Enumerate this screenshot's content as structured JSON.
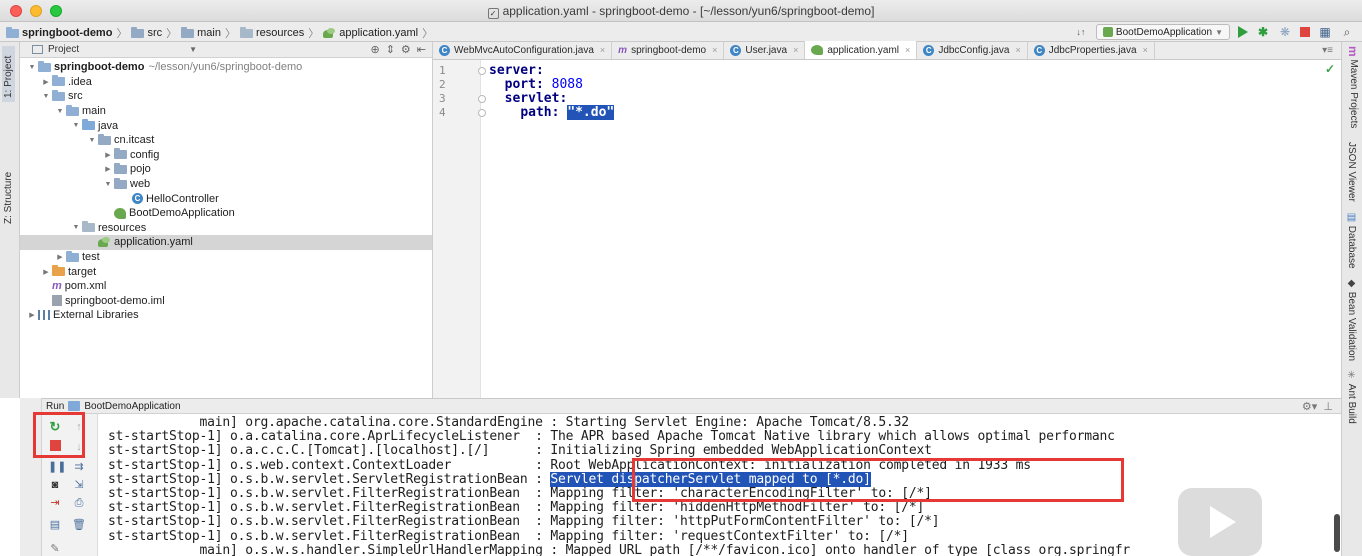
{
  "window": {
    "title": "application.yaml - springboot-demo - [~/lesson/yun6/springboot-demo]"
  },
  "breadcrumbs": [
    "springboot-demo",
    "src",
    "main",
    "resources",
    "application.yaml"
  ],
  "toolbar": {
    "run_config": "BootDemoApplication",
    "sort_indicator": "↓↑"
  },
  "left_strip": {
    "project_tab": "1: Project",
    "structure_tab": "Z: Structure"
  },
  "right_strip": {
    "tabs": [
      "Maven Projects",
      "JSON Viewer",
      "Database",
      "Bean Validation",
      "Ant Build"
    ]
  },
  "project_panel": {
    "header_label": "Project",
    "tree": [
      {
        "label": "springboot-demo",
        "path": "~/lesson/yun6/springboot-demo",
        "depth": 0,
        "expanded": true,
        "icon": "folder-icon",
        "bold": true
      },
      {
        "label": ".idea",
        "depth": 1,
        "expanded": false,
        "icon": "folder-icon"
      },
      {
        "label": "src",
        "depth": 1,
        "expanded": true,
        "icon": "folder-icon"
      },
      {
        "label": "main",
        "depth": 2,
        "expanded": true,
        "icon": "folder-icon"
      },
      {
        "label": "java",
        "depth": 3,
        "expanded": true,
        "icon": "source-folder-icon"
      },
      {
        "label": "cn.itcast",
        "depth": 4,
        "expanded": true,
        "icon": "package-icon"
      },
      {
        "label": "config",
        "depth": 5,
        "expanded": false,
        "icon": "package-icon"
      },
      {
        "label": "pojo",
        "depth": 5,
        "expanded": false,
        "icon": "package-icon"
      },
      {
        "label": "web",
        "depth": 5,
        "expanded": true,
        "icon": "package-icon"
      },
      {
        "label": "HelloController",
        "depth": 6,
        "icon": "class-icon"
      },
      {
        "label": "BootDemoApplication",
        "depth": 5,
        "icon": "spring-boot-icon"
      },
      {
        "label": "resources",
        "depth": 3,
        "expanded": true,
        "icon": "resources-folder-icon"
      },
      {
        "label": "application.yaml",
        "depth": 4,
        "icon": "yaml-icon",
        "selected": true
      },
      {
        "label": "test",
        "depth": 2,
        "expanded": false,
        "icon": "folder-icon"
      },
      {
        "label": "target",
        "depth": 1,
        "expanded": false,
        "icon": "excluded-folder-icon"
      },
      {
        "label": "pom.xml",
        "depth": 1,
        "icon": "maven-icon"
      },
      {
        "label": "springboot-demo.iml",
        "depth": 1,
        "icon": "iml-icon"
      },
      {
        "label": "External Libraries",
        "depth": 0,
        "expanded": false,
        "icon": "library-icon"
      }
    ]
  },
  "editor_tabs": [
    {
      "label": "WebMvcAutoConfiguration.java",
      "icon": "class-icon",
      "active": false
    },
    {
      "label": "springboot-demo",
      "icon": "maven-icon",
      "active": false
    },
    {
      "label": "User.java",
      "icon": "class-icon",
      "active": false
    },
    {
      "label": "application.yaml",
      "icon": "yaml-icon",
      "active": true
    },
    {
      "label": "JdbcConfig.java",
      "icon": "class-icon",
      "active": false
    },
    {
      "label": "JdbcProperties.java",
      "icon": "class-icon",
      "active": false
    }
  ],
  "editor": {
    "lines": [
      {
        "number": "1",
        "key": "server:",
        "value": ""
      },
      {
        "number": "2",
        "key": "port:",
        "value": "8088"
      },
      {
        "number": "3",
        "key": "servlet:",
        "value": ""
      },
      {
        "number": "4",
        "key": "path:",
        "value": "\"*.do\""
      }
    ]
  },
  "run_panel": {
    "label": "Run",
    "config_name": "BootDemoApplication",
    "console_lines": [
      {
        "thread": "            main]",
        "logger": "org.apache.catalina.core.StandardEngine",
        "message": ": Starting Servlet Engine: Apache Tomcat/8.5.32"
      },
      {
        "thread": "st-startStop-1]",
        "logger": "o.a.catalina.core.AprLifecycleListener",
        "message": ": The APR based Apache Tomcat Native library which allows optimal performanc"
      },
      {
        "thread": "st-startStop-1]",
        "logger": "o.a.c.c.C.[Tomcat].[localhost].[/]",
        "message": ": Initializing Spring embedded WebApplicationContext"
      },
      {
        "thread": "st-startStop-1]",
        "logger": "o.s.web.context.ContextLoader",
        "message": ": Root WebApplicationContext: initialization completed in 1933 ms"
      },
      {
        "thread": "st-startStop-1]",
        "logger": "o.s.b.w.servlet.ServletRegistrationBean",
        "message": "Servlet dispatcherServlet mapped to [*.do]"
      },
      {
        "thread": "st-startStop-1]",
        "logger": "o.s.b.w.servlet.FilterRegistrationBean",
        "message": ": Mapping filter: 'characterEncodingFilter' to: [/*]"
      },
      {
        "thread": "st-startStop-1]",
        "logger": "o.s.b.w.servlet.FilterRegistrationBean",
        "message": ": Mapping filter: 'hiddenHttpMethodFilter' to: [/*]"
      },
      {
        "thread": "st-startStop-1]",
        "logger": "o.s.b.w.servlet.FilterRegistrationBean",
        "message": ": Mapping filter: 'httpPutFormContentFilter' to: [/*]"
      },
      {
        "thread": "st-startStop-1]",
        "logger": "o.s.b.w.servlet.FilterRegistrationBean",
        "message": ": Mapping filter: 'requestContextFilter' to: [/*]"
      },
      {
        "thread": "            main]",
        "logger": "o.s.w.s.handler.SimpleUrlHandlerMapping",
        "message": ": Mapped URL path [/**/favicon.ico] onto handler of type [class org.springfr"
      }
    ]
  },
  "colors": {
    "annotation_red": "#e53935",
    "selection_blue": "#2154b6",
    "yaml_key": "#000080",
    "yaml_value": "#0000ff"
  }
}
